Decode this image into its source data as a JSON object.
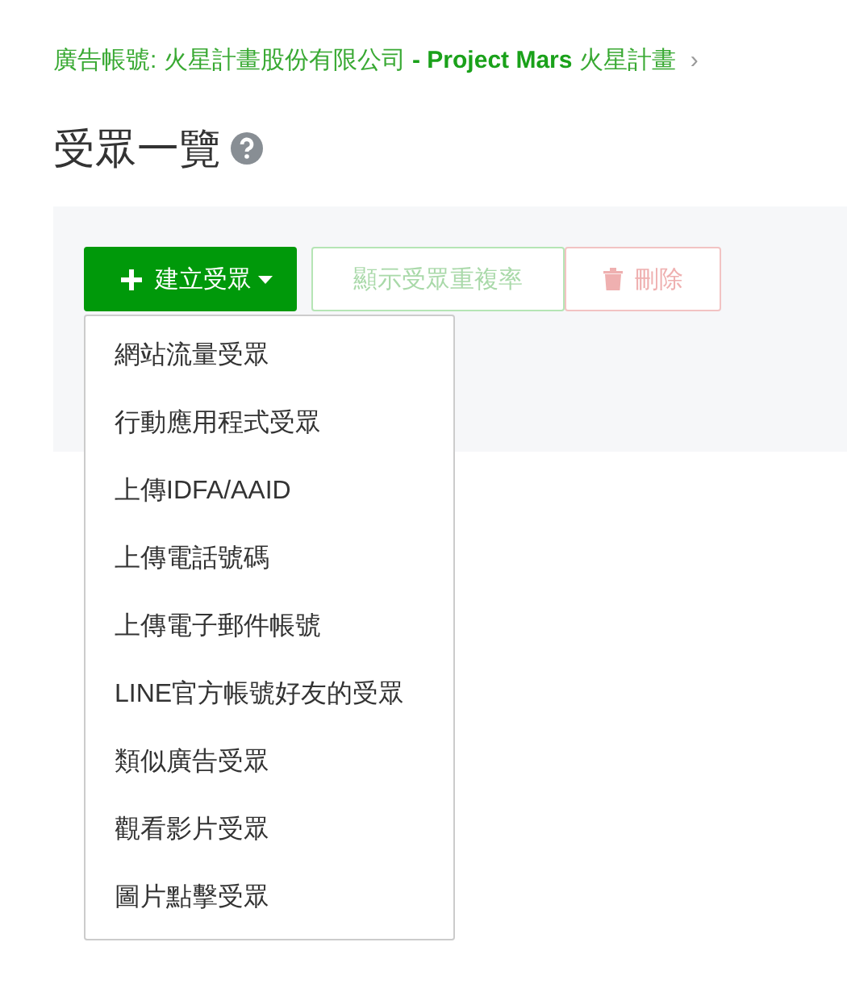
{
  "breadcrumb": {
    "text": "廣告帳號: 火星計畫股份有限公司 **- Project Mars** 火星計畫",
    "separator": "›"
  },
  "title": "受眾一覽",
  "toolbar": {
    "create_button": {
      "label": "建立受眾",
      "expanded": true
    },
    "buttons": [
      {
        "kind": "outline",
        "label": "顯示受眾重複率",
        "disabled": true
      },
      {
        "kind": "delete",
        "label": "刪除",
        "disabled": true
      }
    ]
  },
  "dropdown_menu": [
    "網站流量受眾",
    "行動應用程式受眾",
    "上傳IDFA/AAID",
    "上傳電話號碼",
    "上傳電子郵件帳號",
    "LINE官方帳號好友的受眾",
    "類似廣告受眾",
    "觀看影片受眾",
    "圖片點擊受眾"
  ]
}
